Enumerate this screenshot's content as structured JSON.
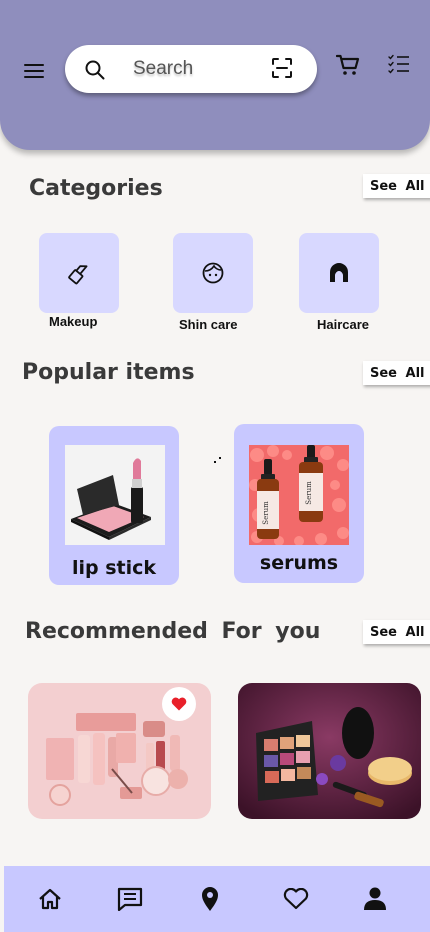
{
  "search": {
    "placeholder": "Search"
  },
  "categories": {
    "title": "Categories",
    "see_all": "See All",
    "items": [
      {
        "label": "Makeup",
        "icon": "lipstick-icon"
      },
      {
        "label": "Shin care",
        "icon": "face-icon"
      },
      {
        "label": "Haircare",
        "icon": "hair-icon"
      }
    ]
  },
  "popular": {
    "title": "Popular items",
    "see_all": "See All",
    "items": [
      {
        "label": "lip stick",
        "image": "lipstick-blush-photo"
      },
      {
        "label": "serums",
        "image": "serum-bottles-photo"
      }
    ]
  },
  "recommended": {
    "title": "Recommended  For you",
    "see_all": "See All",
    "items": [
      {
        "image": "pink-cosmetics-set-photo",
        "favorited": true
      },
      {
        "image": "makeup-palette-photo",
        "favorited": false
      }
    ]
  },
  "bottom_nav": [
    "home-icon",
    "chat-icon",
    "location-icon",
    "heart-icon",
    "profile-icon"
  ],
  "colors": {
    "header": "#8f8ebd",
    "card": "#d8d8ff",
    "popular_card": "#c8c8ff",
    "nav": "#c8c8ff",
    "favorite": "#e8202a"
  }
}
